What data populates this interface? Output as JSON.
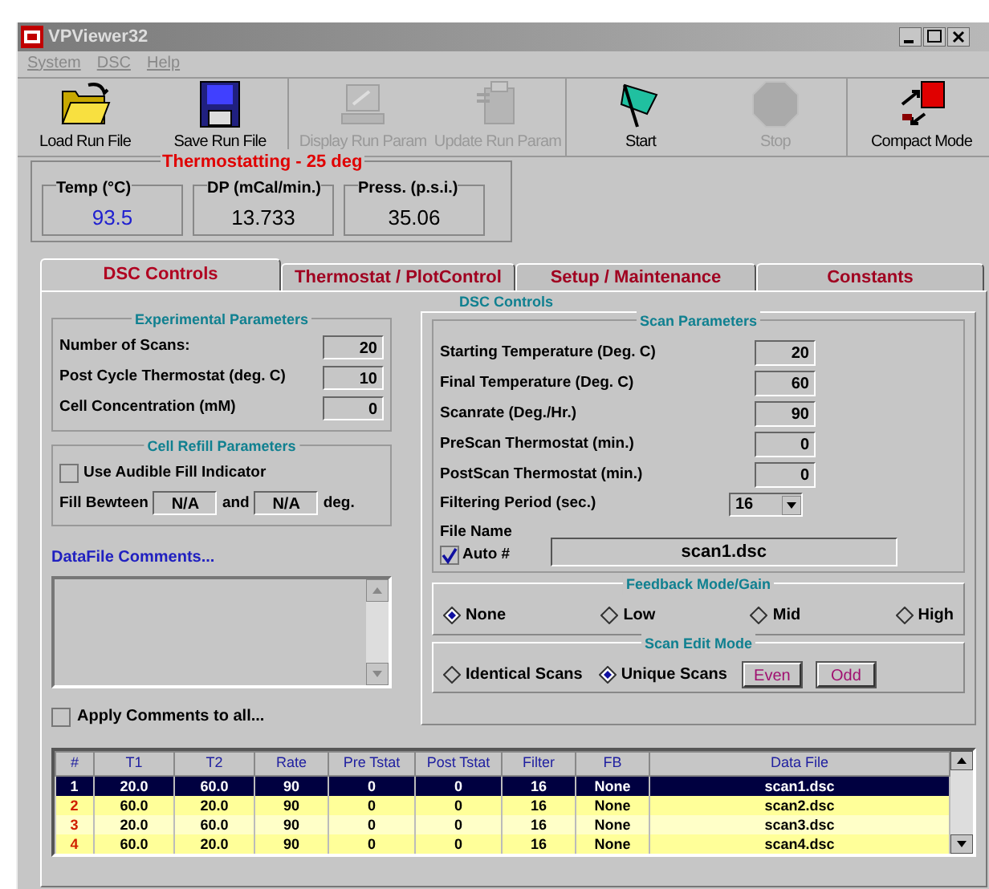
{
  "window": {
    "title": "VPViewer32"
  },
  "menu": [
    "System",
    "DSC",
    "Help"
  ],
  "toolbar": [
    {
      "kind": "open",
      "label": "Load Run File",
      "disabled": false
    },
    {
      "kind": "save",
      "label": "Save Run File",
      "disabled": false
    },
    {
      "kind": "display",
      "label": "Display Run Param",
      "disabled": true
    },
    {
      "kind": "update",
      "label": "Update Run Param",
      "disabled": true
    },
    {
      "kind": "start",
      "label": "Start",
      "disabled": false
    },
    {
      "kind": "stop",
      "label": "Stop",
      "disabled": true
    },
    {
      "kind": "compact",
      "label": "Compact Mode",
      "disabled": false
    }
  ],
  "readouts": {
    "title": "Thermostatting - 25 deg",
    "items": [
      {
        "label": "Temp (°C)",
        "value": "93.5",
        "highlight": true
      },
      {
        "label": "DP (mCal/min.)",
        "value": "13.733",
        "highlight": false
      },
      {
        "label": "Press. (p.s.i.)",
        "value": "35.06",
        "highlight": false
      }
    ]
  },
  "tabs": [
    {
      "label": "DSC Controls",
      "selected": true
    },
    {
      "label": "Thermostat / PlotControl",
      "selected": false
    },
    {
      "label": "Setup / Maintenance",
      "selected": false
    },
    {
      "label": "Constants",
      "selected": false
    }
  ],
  "panel_title": "DSC Controls",
  "experimental": {
    "title": "Experimental Parameters",
    "fields": [
      {
        "label": "Number of Scans:",
        "value": "20"
      },
      {
        "label": "Post Cycle Thermostat (deg. C)",
        "value": "10"
      },
      {
        "label": "Cell Concentration (mM)",
        "value": "0"
      }
    ]
  },
  "cell_refill": {
    "title": "Cell Refill Parameters",
    "audible": {
      "label": "Use Audible Fill Indicator",
      "checked": false
    },
    "fill_label": "Fill Bewteen",
    "from": "N/A",
    "and": "and",
    "to": "N/A",
    "unit": "deg."
  },
  "comments": {
    "label": "DataFile Comments...",
    "apply": {
      "label": "Apply Comments to all...",
      "checked": false
    }
  },
  "scan": {
    "title": "Scan Parameters",
    "fields": [
      {
        "label": "Starting Temperature (Deg. C)",
        "value": "20"
      },
      {
        "label": "Final Temperature (Deg. C)",
        "value": "60"
      },
      {
        "label": "Scanrate (Deg./Hr.)",
        "value": "90"
      },
      {
        "label": "PreScan Thermostat (min.)",
        "value": "0"
      },
      {
        "label": "PostScan Thermostat (min.)",
        "value": "0"
      }
    ],
    "filtering": {
      "label": "Filtering Period (sec.)",
      "value": "16"
    },
    "file_name": {
      "label": "File Name",
      "value": "scan1.dsc"
    },
    "auto": {
      "label": "Auto #",
      "checked": true
    }
  },
  "feedback": {
    "title": "Feedback Mode/Gain",
    "options": [
      {
        "label": "None",
        "selected": true
      },
      {
        "label": "Low",
        "selected": false
      },
      {
        "label": "Mid",
        "selected": false
      },
      {
        "label": "High",
        "selected": false
      }
    ]
  },
  "edit_mode": {
    "title": "Scan Edit Mode",
    "options": [
      {
        "label": "Identical Scans",
        "selected": false
      },
      {
        "label": "Unique Scans",
        "selected": true
      }
    ],
    "buttons": [
      "Even",
      "Odd"
    ]
  },
  "table": {
    "columns": [
      "#",
      "T1",
      "T2",
      "Rate",
      "Pre Tstat",
      "Post Tstat",
      "Filter",
      "FB",
      "Data File"
    ],
    "rows": [
      {
        "selected": true,
        "cells": [
          "1",
          "20.0",
          "60.0",
          "90",
          "0",
          "0",
          "16",
          "None",
          "scan1.dsc"
        ]
      },
      {
        "selected": false,
        "cells": [
          "2",
          "60.0",
          "20.0",
          "90",
          "0",
          "0",
          "16",
          "None",
          "scan2.dsc"
        ]
      },
      {
        "selected": false,
        "cells": [
          "3",
          "20.0",
          "60.0",
          "90",
          "0",
          "0",
          "16",
          "None",
          "scan3.dsc"
        ]
      },
      {
        "selected": false,
        "cells": [
          "4",
          "60.0",
          "20.0",
          "90",
          "0",
          "0",
          "16",
          "None",
          "scan4.dsc"
        ]
      }
    ]
  }
}
